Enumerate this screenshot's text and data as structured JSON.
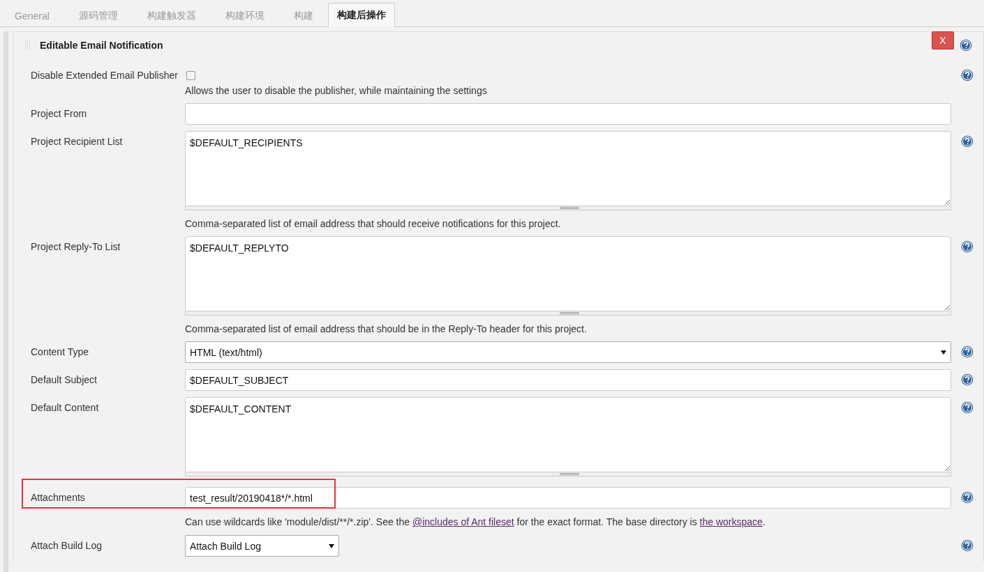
{
  "tabs": [
    {
      "label": "General",
      "selected": false
    },
    {
      "label": "源码管理",
      "selected": false
    },
    {
      "label": "构建触发器",
      "selected": false
    },
    {
      "label": "构建环境",
      "selected": false
    },
    {
      "label": "构建",
      "selected": false
    },
    {
      "label": "构建后操作",
      "selected": true
    }
  ],
  "section": {
    "title": "Editable Email Notification",
    "delete_label": "X",
    "help": true
  },
  "rows": [
    {
      "kind": "checkbox",
      "label": "Disable Extended Email Publisher",
      "checked": false,
      "help": true,
      "description": [
        {
          "text": "Allows the user to disable the publisher, while maintaining the settings"
        }
      ]
    },
    {
      "kind": "text",
      "label": "Project From",
      "value": "",
      "help": false
    },
    {
      "kind": "textarea",
      "label": "Project Recipient List",
      "value": "$DEFAULT_RECIPIENTS",
      "help": true,
      "description": [
        {
          "text": "Comma-separated list of email address that should receive notifications for this project."
        }
      ]
    },
    {
      "kind": "textarea",
      "label": "Project Reply-To List",
      "value": "$DEFAULT_REPLYTO",
      "help": true,
      "description": [
        {
          "text": "Comma-separated list of email address that should be in the Reply-To header for this project."
        }
      ]
    },
    {
      "kind": "select",
      "label": "Content Type",
      "value": "HTML (text/html)",
      "help": true
    },
    {
      "kind": "text",
      "label": "Default Subject",
      "value": "$DEFAULT_SUBJECT",
      "help": true
    },
    {
      "kind": "textarea",
      "label": "Default Content",
      "value": "$DEFAULT_CONTENT",
      "help": true
    },
    {
      "kind": "text",
      "label": "Attachments",
      "value": "test_result/20190418*/*.html",
      "help": true,
      "highlighted": true,
      "description": [
        {
          "text": "Can use wildcards like 'module/dist/**/*.zip'. See the "
        },
        {
          "link": "@includes of Ant fileset"
        },
        {
          "text": " for the exact format. The base directory is "
        },
        {
          "link": "the workspace"
        },
        {
          "text": "."
        }
      ]
    },
    {
      "kind": "select_short",
      "label": "Attach Build Log",
      "value": "Attach Build Log",
      "help": true
    }
  ]
}
